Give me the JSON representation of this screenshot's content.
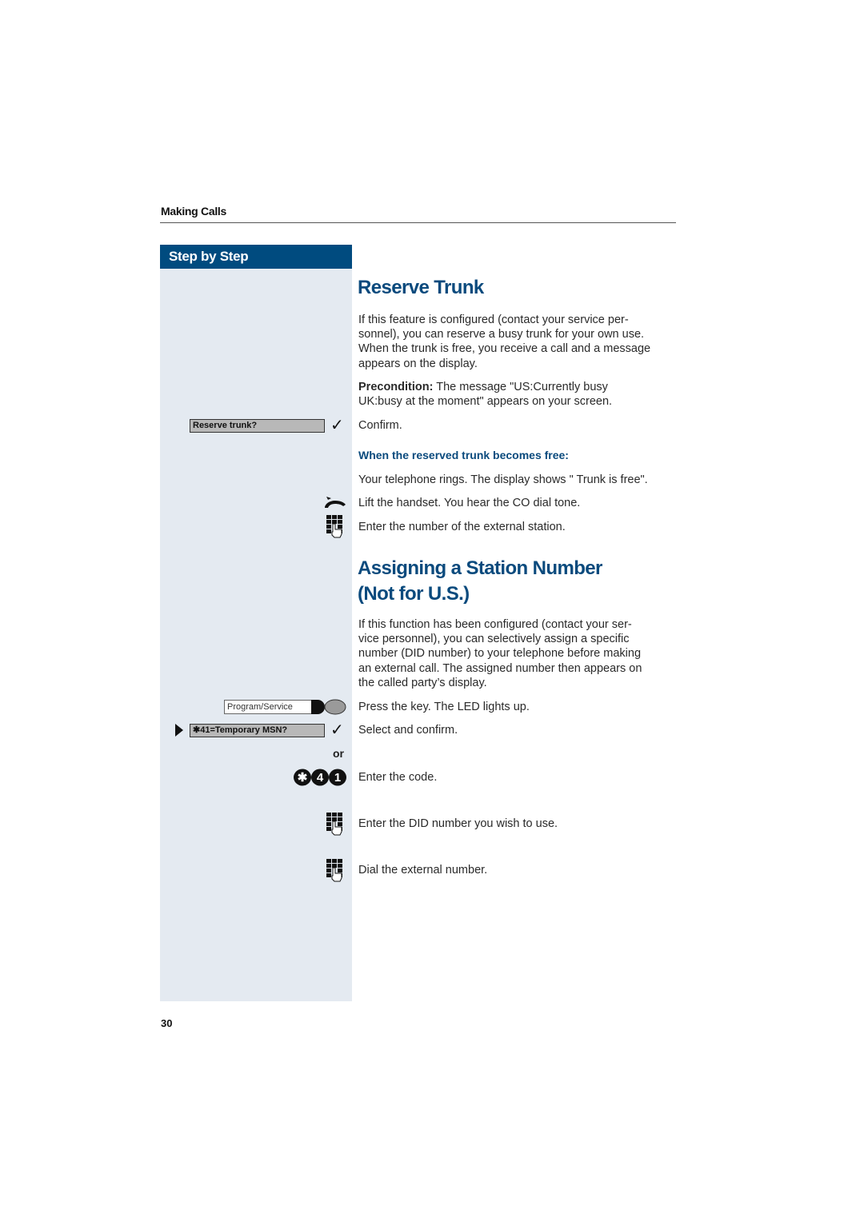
{
  "header": {
    "section": "Making Calls"
  },
  "sidebar": {
    "title": "Step by Step"
  },
  "reserve_trunk": {
    "title": "Reserve Trunk",
    "intro": "If this feature is configured (contact your service per-sonnel), you can reserve a busy trunk for your own use. When the trunk is free, you receive a call and a message appears on the display.",
    "intro_lines": [
      "If this feature is configured (contact your service per-",
      "sonnel), you can reserve a busy trunk for your own use.",
      "When the trunk is free, you receive a call and a message",
      "appears on the display."
    ],
    "precondition_label": "Precondition:",
    "precondition_lines": [
      " The message \"US:Currently busy",
      "UK:busy at the moment\" appears on your screen."
    ],
    "display_prompt": "Reserve trunk?",
    "confirm_text": "Confirm.",
    "subheading": "When the reserved trunk becomes free:",
    "rings_text": "Your telephone rings. The display shows \" Trunk is free\".",
    "lift_text": "Lift the handset. You hear the CO dial tone.",
    "enter_text": "Enter the number of the external station."
  },
  "assign_station": {
    "title_line1": "Assigning a Station Number",
    "title_line2": "(Not for U.S.)",
    "intro_lines": [
      "If this function has been configured (contact your ser-",
      "vice personnel), you can selectively assign a specific",
      "number (DID number) to your telephone before making",
      "an external call. The assigned number then appears on",
      "the called party’s display."
    ],
    "key_label": "Program/Service",
    "press_text": "Press the key. The LED lights up.",
    "display_prompt": "✱41=Temporary MSN?",
    "select_text": "Select and confirm.",
    "or_label": "or",
    "code_keys": [
      "✱",
      "4",
      "1"
    ],
    "code_text": "Enter the code.",
    "did_text": "Enter the DID number you wish to use.",
    "dial_text": "Dial the external number."
  },
  "footer": {
    "page_number": "30"
  }
}
